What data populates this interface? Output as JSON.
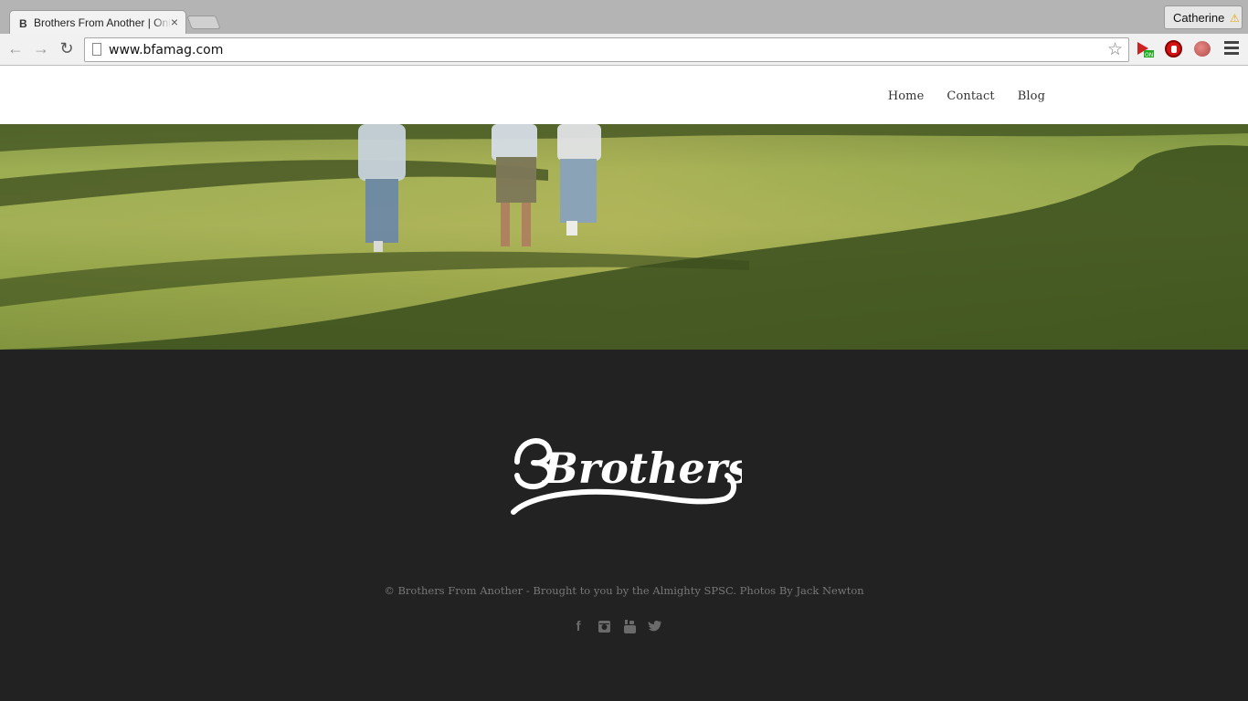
{
  "browser": {
    "tab_title": "Brothers From Another | Online",
    "tab_favicon": "B",
    "close_glyph": "×",
    "url": "www.bfamag.com",
    "profile_name": "Catherine",
    "profile_warning": "⚠",
    "back_glyph": "←",
    "forward_glyph": "→",
    "reload_glyph": "↻",
    "star_glyph": "☆",
    "extensions": [
      "video-on-icon",
      "adblock-icon",
      "apple-extension-icon"
    ]
  },
  "nav": {
    "home": "Home",
    "contact": "Contact",
    "blog": "Blog"
  },
  "footer": {
    "logo_text": "Brothers",
    "credit": "© Brothers From Another - Brought to you by the Almighty SPSC. Photos By Jack Newton",
    "social": {
      "facebook": "f",
      "instagram": "◙",
      "youtube": "▶",
      "twitter": "🐦"
    }
  },
  "colors": {
    "footer_bg": "#222222",
    "header_bg": "#ffffff",
    "nav_text": "#333333",
    "credit_text": "#777777",
    "grass": "#8da74a"
  }
}
